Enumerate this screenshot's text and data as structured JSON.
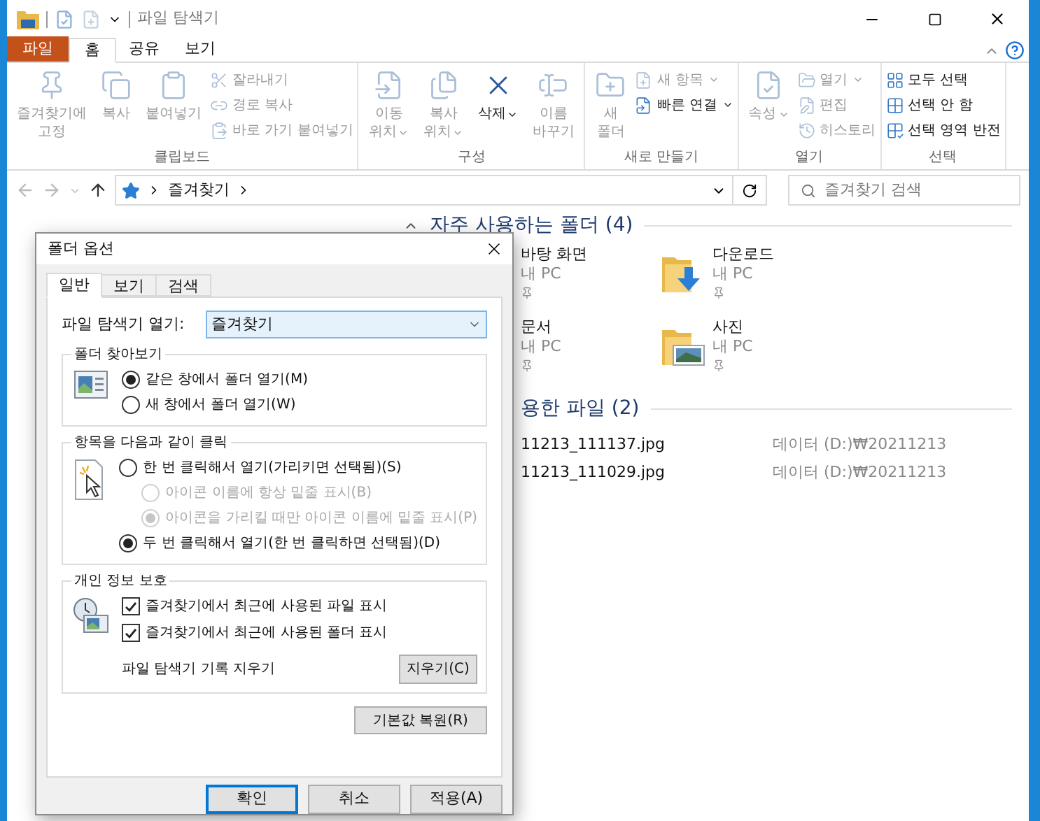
{
  "window": {
    "title": "파일 탐색기"
  },
  "ribbon_tabs": [
    {
      "label": "파일",
      "kind": "file",
      "selected": false
    },
    {
      "label": "홈",
      "kind": "tab",
      "selected": true
    },
    {
      "label": "공유",
      "kind": "tab",
      "selected": false
    },
    {
      "label": "보기",
      "kind": "tab",
      "selected": false
    }
  ],
  "ribbon_groups": [
    {
      "label": "클립보드",
      "items": [
        {
          "kind": "large",
          "lines": [
            "즐겨찾기에",
            "고정"
          ],
          "disabled": true
        },
        {
          "kind": "large",
          "lines": [
            "복사"
          ],
          "disabled": true
        },
        {
          "kind": "large",
          "lines": [
            "붙여넣기"
          ],
          "disabled": true
        },
        {
          "kind": "small",
          "lines": [
            "잘라내기"
          ],
          "disabled": true
        },
        {
          "kind": "small",
          "lines": [
            "경로 복사"
          ],
          "disabled": true
        },
        {
          "kind": "small",
          "lines": [
            "바로 가기 붙여넣기"
          ],
          "disabled": true
        }
      ]
    },
    {
      "label": "구성",
      "items": [
        {
          "kind": "large",
          "lines": [
            "이동",
            "위치"
          ],
          "disabled": true,
          "has_menu": true
        },
        {
          "kind": "large",
          "lines": [
            "복사",
            "위치"
          ],
          "disabled": true,
          "has_menu": true
        },
        {
          "kind": "large",
          "lines": [
            "삭제"
          ],
          "disabled": false,
          "has_menu": true
        },
        {
          "kind": "large",
          "lines": [
            "이름",
            "바꾸기"
          ],
          "disabled": true
        }
      ]
    },
    {
      "label": "새로 만들기",
      "items": [
        {
          "kind": "large",
          "lines": [
            "새",
            "폴더"
          ],
          "disabled": true
        },
        {
          "kind": "small",
          "lines": [
            "새 항목"
          ],
          "disabled": true,
          "has_menu": true
        },
        {
          "kind": "small",
          "lines": [
            "빠른 연결"
          ],
          "disabled": false,
          "has_menu": true
        }
      ]
    },
    {
      "label": "열기",
      "items": [
        {
          "kind": "large",
          "lines": [
            "속성"
          ],
          "disabled": true,
          "has_menu": true
        },
        {
          "kind": "small",
          "lines": [
            "열기"
          ],
          "disabled": true,
          "has_menu": true
        },
        {
          "kind": "small",
          "lines": [
            "편집"
          ],
          "disabled": true
        },
        {
          "kind": "small",
          "lines": [
            "히스토리"
          ],
          "disabled": true
        }
      ]
    },
    {
      "label": "선택",
      "items": [
        {
          "kind": "small",
          "lines": [
            "모두 선택"
          ],
          "disabled": false
        },
        {
          "kind": "small",
          "lines": [
            "선택 안 함"
          ],
          "disabled": false
        },
        {
          "kind": "small",
          "lines": [
            "선택 영역 반전"
          ],
          "disabled": false
        }
      ]
    }
  ],
  "address": {
    "path": [
      "즐겨찾기"
    ],
    "search_placeholder": "즐겨찾기 검색"
  },
  "content": {
    "sections": [
      {
        "kind": "folders",
        "title": "자주 사용하는 폴더 (4)",
        "items": [
          {
            "kind": "desktop",
            "name": "바탕 화면",
            "location": "내 PC",
            "pinned": true
          },
          {
            "kind": "download",
            "name": "다운로드",
            "location": "내 PC",
            "pinned": true
          },
          {
            "kind": "documents",
            "name": "문서",
            "location": "내 PC",
            "pinned": true
          },
          {
            "kind": "pictures",
            "name": "사진",
            "location": "내 PC",
            "pinned": true
          }
        ]
      },
      {
        "kind": "files",
        "title": "용한 파일 (2)",
        "items": [
          {
            "name": "11213_111137.jpg",
            "location": "데이터 (D:)₩20211213"
          },
          {
            "name": "11213_111029.jpg",
            "location": "데이터 (D:)₩20211213"
          }
        ]
      }
    ]
  },
  "dialog": {
    "title": "폴더 옵션",
    "tabs": [
      {
        "label": "일반",
        "selected": true
      },
      {
        "label": "보기",
        "selected": false
      },
      {
        "label": "검색",
        "selected": false
      }
    ],
    "open_with": {
      "label": "파일 탐색기 열기:",
      "value": "즐겨찾기"
    },
    "groups": [
      {
        "kind": "radios",
        "title": "폴더 찾아보기",
        "options": [
          {
            "label": "같은 창에서 폴더 열기(M)",
            "selected": true,
            "disabled": false
          },
          {
            "label": "새 창에서 폴더 열기(W)",
            "selected": false,
            "disabled": false
          }
        ]
      },
      {
        "kind": "radios",
        "title": "항목을 다음과 같이 클릭",
        "options": [
          {
            "label": "한 번 클릭해서 열기(가리키면 선택됨)(S)",
            "selected": false,
            "disabled": false,
            "children": [
              {
                "label": "아이콘 이름에 항상 밑줄 표시(B)",
                "selected": false,
                "disabled": true
              },
              {
                "label": "아이콘을 가리킬 때만 아이콘 이름에 밑줄 표시(P)",
                "selected": true,
                "disabled": true
              }
            ]
          },
          {
            "label": "두 번 클릭해서 열기(한 번 클릭하면 선택됨)(D)",
            "selected": true,
            "disabled": false
          }
        ]
      },
      {
        "kind": "checks",
        "title": "개인 정보 보호",
        "options": [
          {
            "label": "즐겨찾기에서 최근에 사용된 파일 표시",
            "checked": true
          },
          {
            "label": "즐겨찾기에서 최근에 사용된 폴더 표시",
            "checked": true
          }
        ],
        "clear": {
          "label": "파일 탐색기 기록 지우기",
          "button": "지우기(C)"
        }
      }
    ],
    "restore_button": "기본값 복원(R)",
    "buttons": [
      {
        "label": "확인",
        "default": true
      },
      {
        "label": "취소",
        "default": false
      },
      {
        "label": "적용(A)",
        "default": false
      }
    ]
  }
}
